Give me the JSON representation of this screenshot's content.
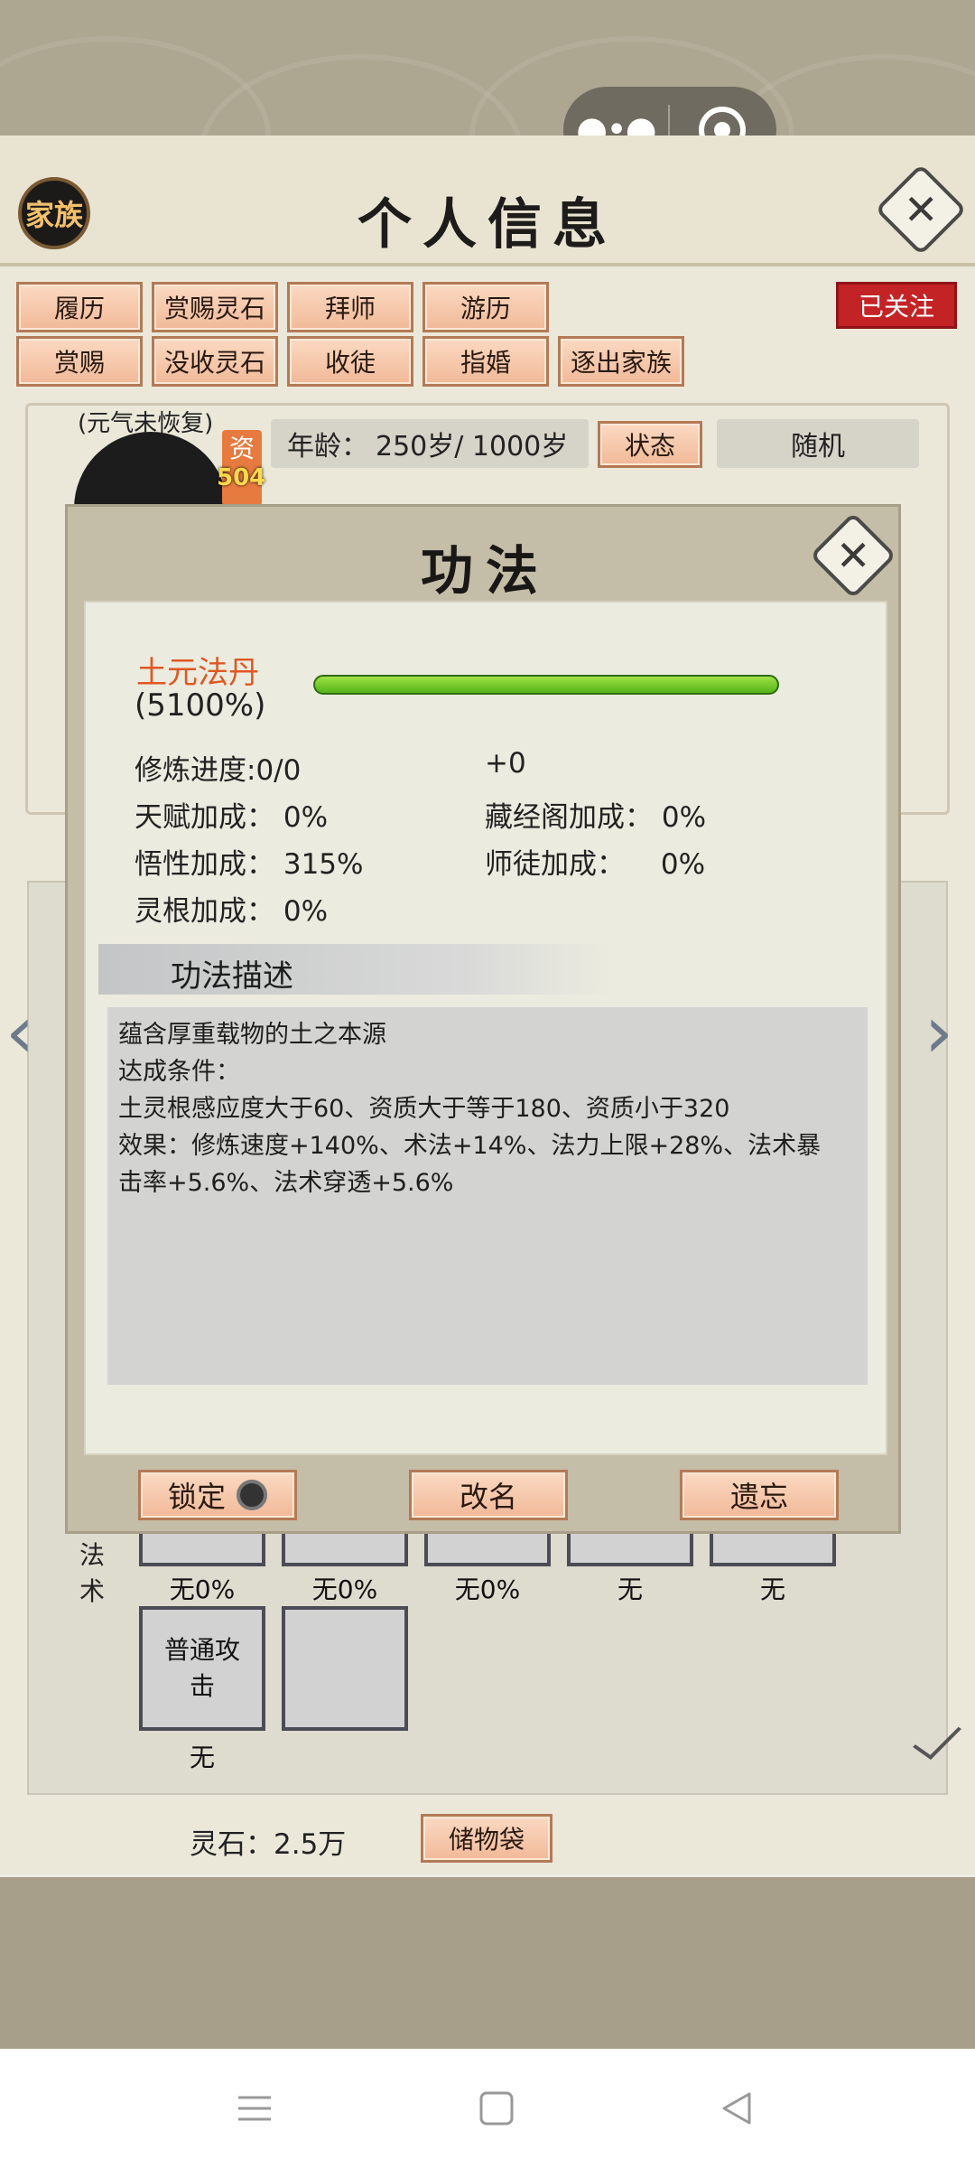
{
  "mini_program": {
    "more_icon": "more-dots-icon",
    "close_icon": "target-circle-icon"
  },
  "header": {
    "clan_label": "家族",
    "title": "个人信息",
    "close_symbol": "✕"
  },
  "action_buttons": {
    "row1": [
      "履历",
      "赏赐灵石",
      "拜师",
      "游历"
    ],
    "row2": [
      "赏赐",
      "没收灵石",
      "收徒",
      "指婚",
      "逐出家族"
    ],
    "followed": "已关注"
  },
  "profile": {
    "status_note": "(元气未恢复)",
    "aptitude_label": "资",
    "aptitude_value": "504",
    "age_label": "年龄：",
    "age_value": "250岁/ 1000岁",
    "state_button": "状态",
    "random_button": "随机"
  },
  "modal": {
    "title": "功法",
    "close_symbol": "✕",
    "technique_name": "土元法丹",
    "technique_percent": "(5100%)",
    "progress_fraction": 1.0,
    "stats": {
      "cultivation_progress": "修炼进度:0/0",
      "bonus_plus": "+0",
      "talent_label": "天赋加成：",
      "talent_value": "0%",
      "library_label": "藏经阁加成：",
      "library_value": "0%",
      "comprehension_label": "悟性加成：",
      "comprehension_value": "315%",
      "master_label": "师徒加成：",
      "master_value": "0%",
      "spirit_root_label": "灵根加成：",
      "spirit_root_value": "0%"
    },
    "desc_header": "功法描述",
    "desc_lines": [
      "蕴含厚重载物的土之本源",
      "达成条件：",
      "土灵根感应度大于60、资质大于等于180、资质小于320",
      "效果：修炼速度+140%、术法+14%、法力上限+28%、法术暴",
      "击率+5.6%、法术穿透+5.6%"
    ],
    "buttons": {
      "lock": "锁定",
      "rename": "改名",
      "forget": "遗忘"
    }
  },
  "skills": {
    "section_label_1": "法",
    "section_label_2": "术",
    "row1_captions": [
      "无0%",
      "无0%",
      "无0%",
      "无",
      "无"
    ],
    "row2": [
      {
        "name": "普通攻击",
        "caption": "无"
      },
      {
        "name": "",
        "caption": ""
      }
    ]
  },
  "footer": {
    "spirit_stone": "灵石：2.5万",
    "bag_button": "储物袋"
  },
  "colors": {
    "accent_orange": "#e05722",
    "followed_red": "#c42326",
    "progress_green": "#55b318"
  }
}
